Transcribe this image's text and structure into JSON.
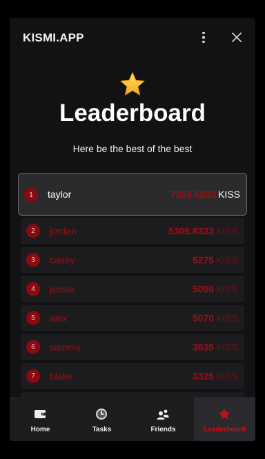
{
  "app": {
    "title": "KISMI.APP"
  },
  "hero": {
    "icon": "star-icon",
    "title": "Leaderboard",
    "subtitle": "Here be the best of the best"
  },
  "colors": {
    "accent": "#9a0f17",
    "badge": "#8a0a10",
    "panel": "#121214"
  },
  "leaderboard": [
    {
      "rank": "1",
      "name": "taylor",
      "score": "7253.5833",
      "unit": "KISS",
      "current_user": true
    },
    {
      "rank": "2",
      "name": "jordan",
      "score": "5306.8333",
      "unit": "KISS"
    },
    {
      "rank": "3",
      "name": "casey",
      "score": "5275",
      "unit": "KISS"
    },
    {
      "rank": "4",
      "name": "jessie",
      "score": "5090",
      "unit": "KISS"
    },
    {
      "rank": "5",
      "name": "alex",
      "score": "5070",
      "unit": "KISS"
    },
    {
      "rank": "6",
      "name": "sammy",
      "score": "3635",
      "unit": "KISS"
    },
    {
      "rank": "7",
      "name": "blake",
      "score": "3325",
      "unit": "KISS"
    }
  ],
  "nav": [
    {
      "label": "Home",
      "icon": "wallet-icon"
    },
    {
      "label": "Tasks",
      "icon": "clock-icon"
    },
    {
      "label": "Friends",
      "icon": "friends-icon"
    },
    {
      "label": "Leaderboard",
      "icon": "star-icon",
      "active": true
    }
  ]
}
